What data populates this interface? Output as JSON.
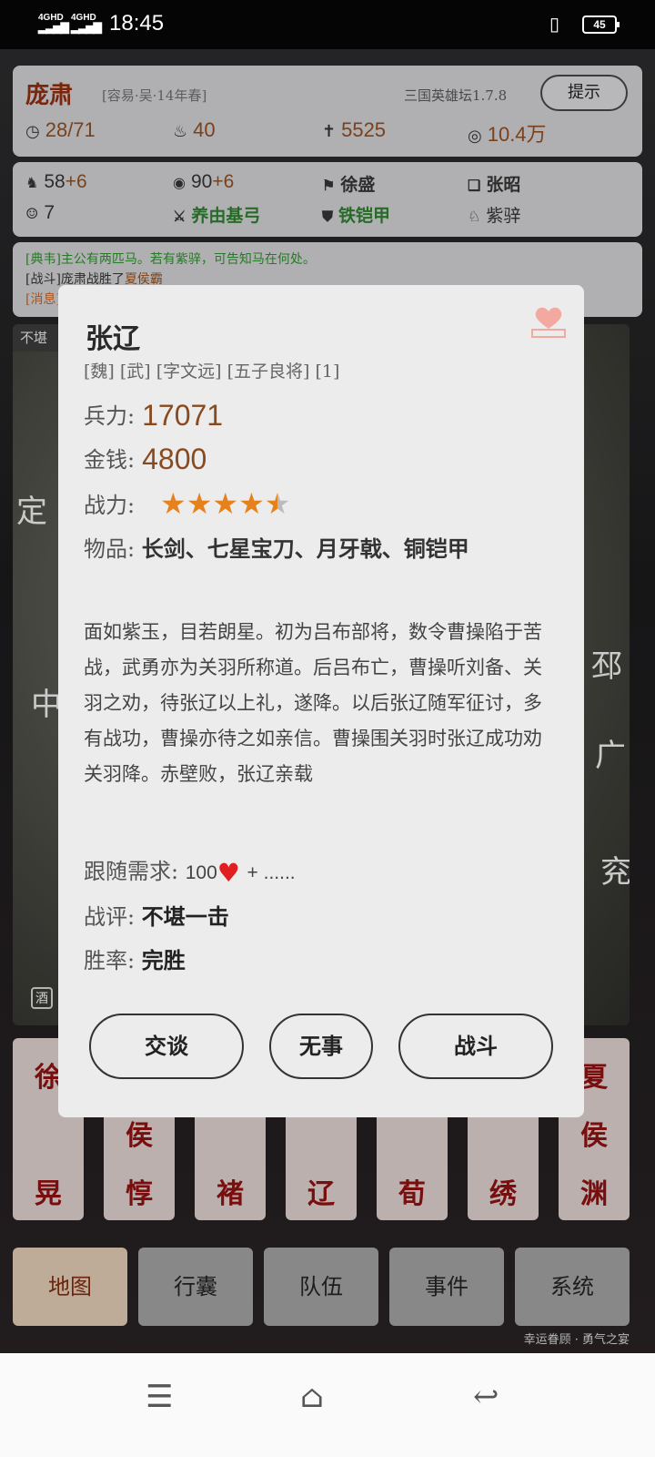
{
  "status_bar": {
    "net1": "4GHD",
    "net2": "4GHD",
    "time": "18:45",
    "battery": "45"
  },
  "header": {
    "name": "庞肃",
    "subtitle": "[容易·吴·14年春]",
    "version": "三国英雄坛1.7.8",
    "hint_label": "提示",
    "turn": "28/71",
    "food": "40",
    "troops": "5525",
    "money": "10.4万"
  },
  "attrs": {
    "horse_val": "58",
    "horse_plus": "+6",
    "intel_val": "90",
    "intel_plus": "+6",
    "general1": "徐盛",
    "general2": "张昭",
    "followers": "7",
    "weapon": "养由基弓",
    "armor": "铁铠甲",
    "mount": "紫骍"
  },
  "log": {
    "line1": "[典韦]主公有两匹马。若有紫骍，可告知马在何处。",
    "line2_prefix": "[战斗]庞肃战胜了",
    "line2_em": "夏侯霸",
    "line3": "[消息]"
  },
  "map": {
    "corner_label": "不堪",
    "labels": [
      "定",
      "中",
      "邳",
      "广",
      "兖"
    ],
    "wine_label": "酒"
  },
  "general_cards": [
    {
      "top": "徐",
      "bottom": "晃"
    },
    {
      "top": "侯",
      "bottom": "惇"
    },
    {
      "top": "",
      "bottom": "褚"
    },
    {
      "top": "",
      "bottom": "辽"
    },
    {
      "top": "",
      "bottom": "荀"
    },
    {
      "top": "",
      "bottom": "绣"
    },
    {
      "top": "夏",
      "mid": "侯",
      "bottom": "渊"
    }
  ],
  "tabs": [
    "地图",
    "行囊",
    "队伍",
    "事件",
    "系统"
  ],
  "footer": "幸运眷顾 · 勇气之宴",
  "modal": {
    "name": "张辽",
    "tags": "[魏] [武] [字文远] [五子良将] [1]",
    "troops_label": "兵力:",
    "troops": "17071",
    "money_label": "金钱:",
    "money": "4800",
    "power_label": "战力:",
    "power_stars": 4.5,
    "items_label": "物品:",
    "items": "长剑、七星宝刀、月牙戟、铜铠甲",
    "desc": "面如紫玉，目若朗星。初为吕布部将，数令曹操陷于苦战，武勇亦为关羽所称道。后吕布亡，曹操听刘备、关羽之劝，待张辽以上礼，遂降。以后张辽随军征讨，多有战功，曹操亦待之如亲信。曹操围关羽时张辽成功劝关羽降。赤壁败，张辽亲载",
    "follow_label": "跟随需求:",
    "follow_val": "100",
    "follow_more": "+ ......",
    "review_label": "战评:",
    "review": "不堪一击",
    "rate_label": "胜率:",
    "rate": "完胜",
    "btn_talk": "交谈",
    "btn_none": "无事",
    "btn_fight": "战斗"
  },
  "colors": {
    "accent": "#8a2c10",
    "star": "#e6821e",
    "heart": "#e02020",
    "green": "#2c7a2c"
  }
}
